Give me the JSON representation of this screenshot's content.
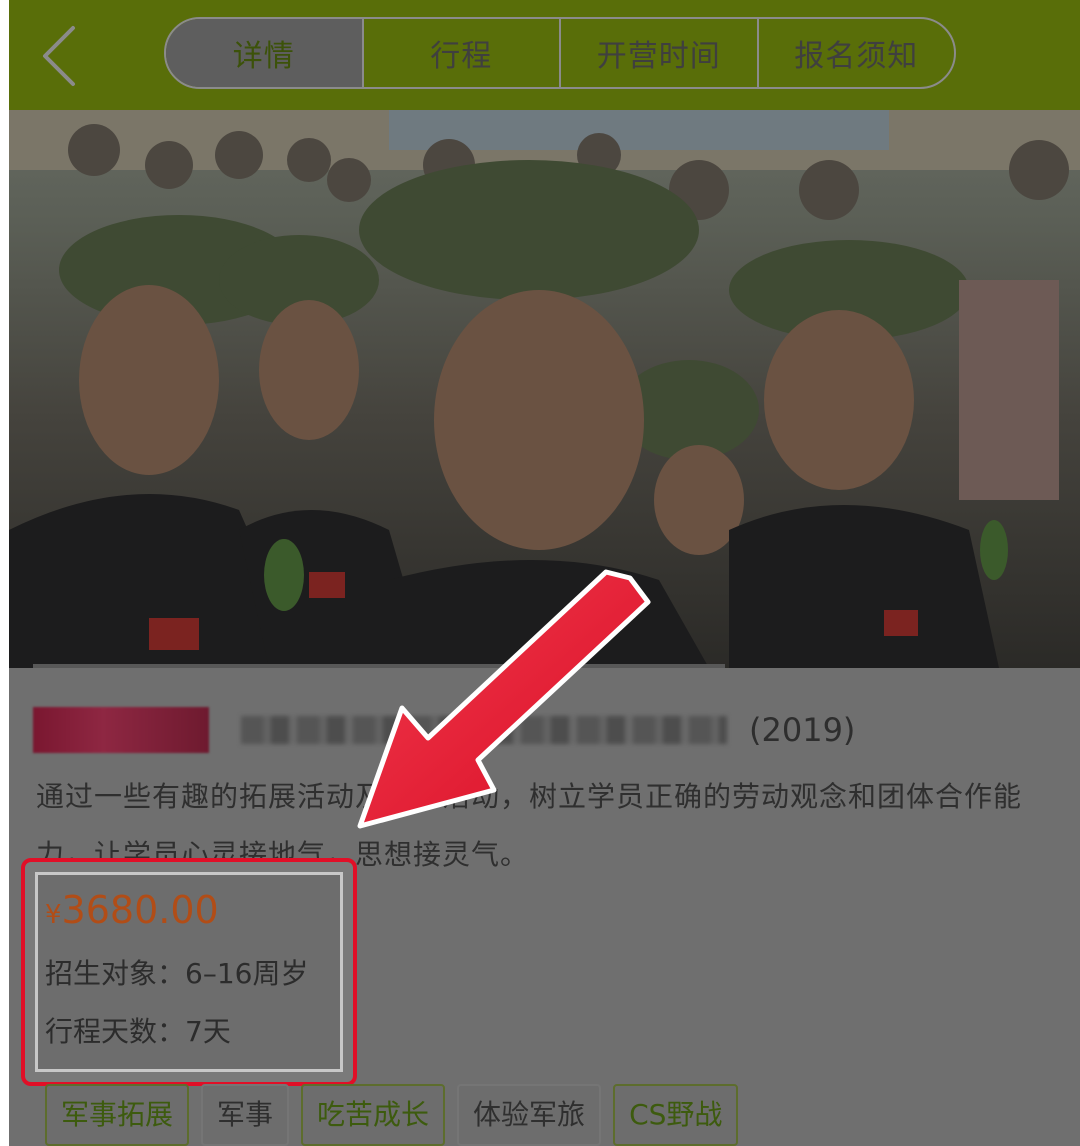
{
  "header": {
    "back_icon": "chevron-left-icon",
    "tabs": [
      {
        "label": "详情",
        "active": true
      },
      {
        "label": "行程",
        "active": false
      },
      {
        "label": "开营时间",
        "active": false
      },
      {
        "label": "报名须知",
        "active": false
      }
    ]
  },
  "product": {
    "title_suffix": "(2019)",
    "description": "通过一些有趣的拓展活动及劳动活动，树立学员正确的劳动观念和团体合作能力，让学员心灵接地气，思想接灵气。",
    "price_symbol": "¥",
    "price_value": "3680.00",
    "target_label": "招生对象：6–16周岁",
    "duration_label": "行程天数：7天"
  },
  "tags": [
    "军事拓展",
    "军事",
    "吃苦成长",
    "体验军旅",
    "CS野战"
  ],
  "colors": {
    "header_bg": "#596e09",
    "highlight_border": "#e10f27",
    "price": "#b14d17"
  }
}
